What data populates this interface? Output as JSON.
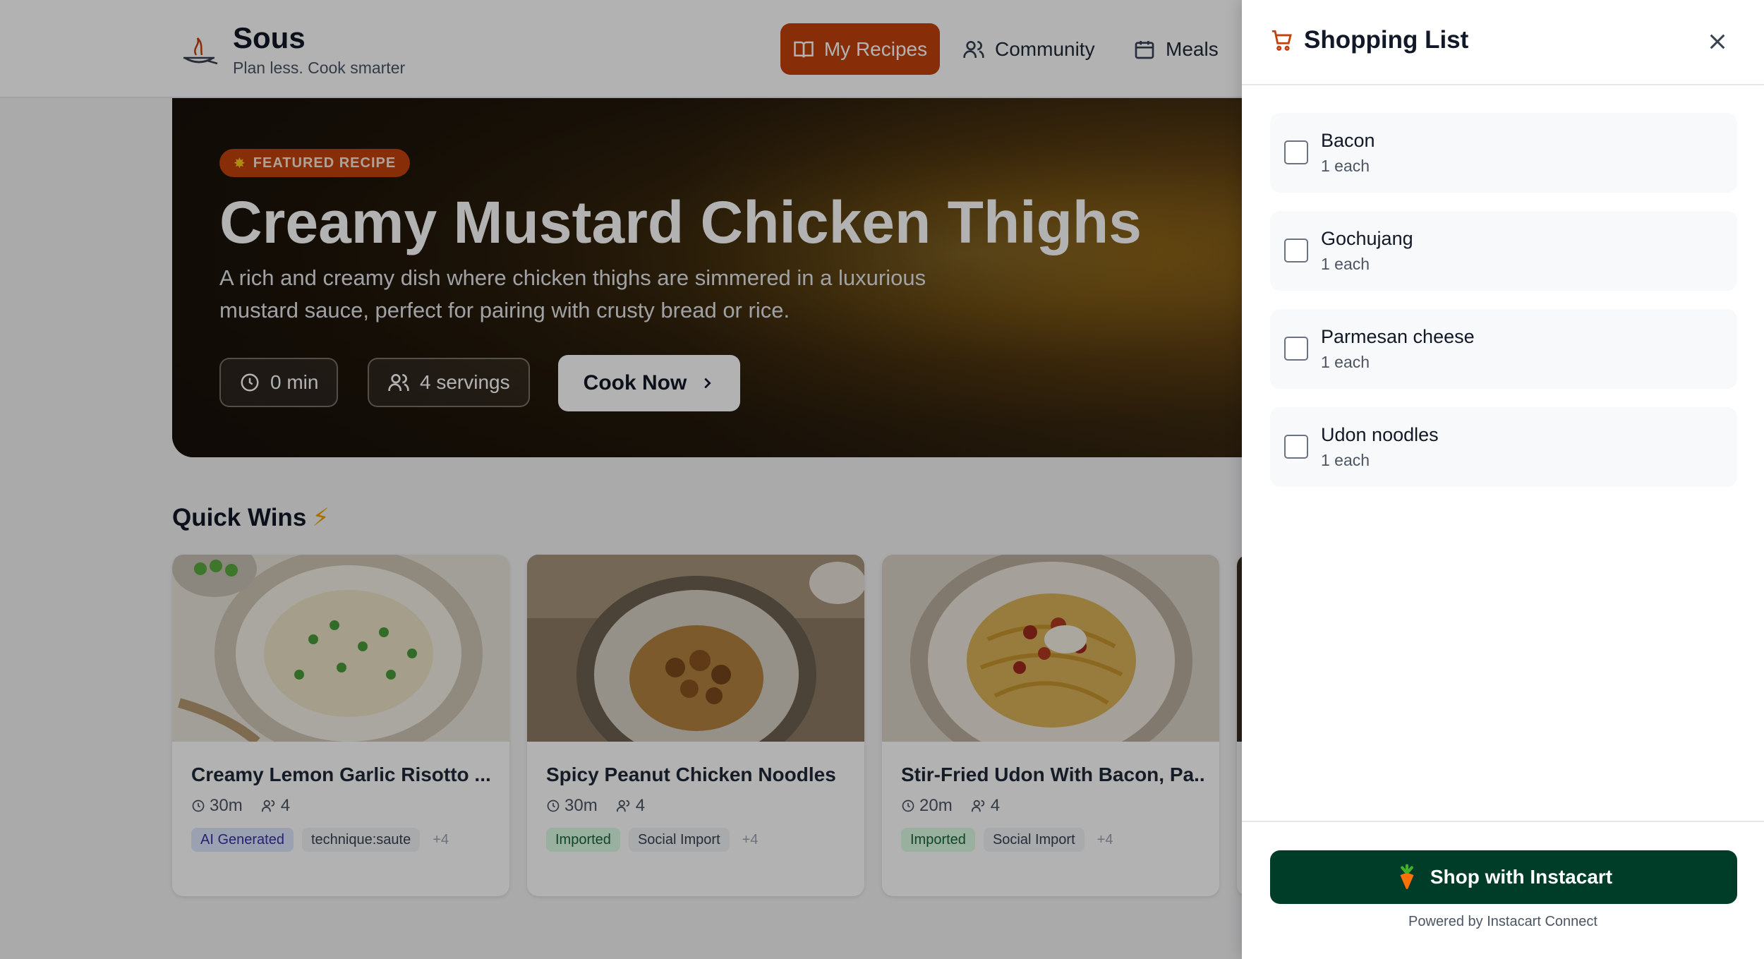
{
  "brand": {
    "name": "Sous",
    "tagline": "Plan less. Cook smarter"
  },
  "nav": {
    "my_recipes": "My Recipes",
    "community": "Community",
    "meals": "Meals"
  },
  "hero": {
    "badge": "FEATURED RECIPE",
    "title": "Creamy Mustard Chicken Thighs",
    "description": "A rich and creamy dish where chicken thighs are simmered in a luxurious mustard sauce, perfect for pairing with crusty bread or rice.",
    "time": "0 min",
    "servings": "4 servings",
    "cook_label": "Cook Now"
  },
  "quick_wins": {
    "title": "Quick Wins",
    "cards": [
      {
        "title": "Creamy Lemon Garlic Risotto ...",
        "time": "30m",
        "servings": "4",
        "tag1": "AI Generated",
        "tag2": "technique:saute",
        "more": "+4"
      },
      {
        "title": "Spicy Peanut Chicken Noodles",
        "time": "30m",
        "servings": "4",
        "tag1": "Imported",
        "tag2": "Social Import",
        "more": "+4"
      },
      {
        "title": "Stir-Fried Udon With Bacon, Pa...",
        "time": "20m",
        "servings": "4",
        "tag1": "Imported",
        "tag2": "Social Import",
        "more": "+4"
      }
    ]
  },
  "drawer": {
    "title": "Shopping List",
    "items": [
      {
        "name": "Bacon",
        "qty": "1 each",
        "checked": false
      },
      {
        "name": "Gochujang",
        "qty": "1 each",
        "checked": false
      },
      {
        "name": "Parmesan cheese",
        "qty": "1 each",
        "checked": false
      },
      {
        "name": "Udon noodles",
        "qty": "1 each",
        "checked": false
      }
    ],
    "shop_button": "Shop with Instacart",
    "powered_by": "Powered by Instacart Connect"
  },
  "colors": {
    "accent": "#c2410c",
    "instacart_green": "#003d29",
    "tag_ai": "#e0e7ff",
    "tag_imported": "#dcfce7"
  },
  "icons": [
    "chef-logo-icon",
    "book-icon",
    "users-icon",
    "calendar-icon",
    "clock-icon",
    "chevron-right-icon",
    "bolt-icon",
    "cart-icon",
    "close-icon",
    "carrot-icon"
  ]
}
